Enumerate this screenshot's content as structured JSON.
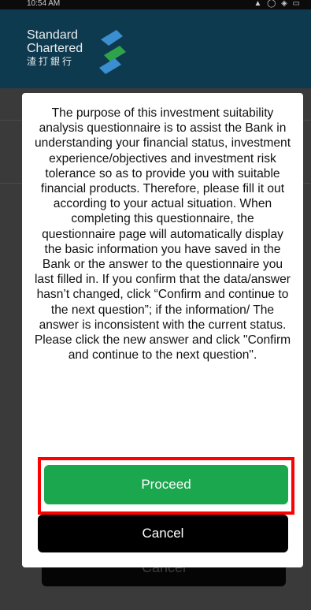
{
  "status_bar": {
    "time": "10:54 AM",
    "icons": "▲ ◯ ◈ ▭"
  },
  "brand": {
    "line1": "Standard",
    "line2": "Chartered",
    "line3": "渣打銀行",
    "logo": "standard-chartered-logo"
  },
  "modal": {
    "message": "The purpose of this investment suitability analysis questionnaire is to assist the Bank in understanding your financial status, investment experience/objectives and investment risk tolerance so as to provide you with suitable financial products. Therefore, please fill it out according to your actual situation. When completing this questionnaire, the questionnaire page will automatically display the basic information you have saved in the Bank or the answer to the questionnaire you last filled in. If you confirm that the data/answer hasn’t changed, click “Confirm and continue to the next question”; if the information/ The answer is inconsistent with the current status. Please click the new answer and click \"Confirm and continue to the next question\".",
    "proceed_label": "Proceed",
    "cancel_label": "Cancel"
  },
  "background": {
    "cancel_label": "Cancel"
  },
  "colors": {
    "header": "#0e3a4f",
    "proceed": "#1ba74e",
    "highlight": "#ff0000"
  }
}
